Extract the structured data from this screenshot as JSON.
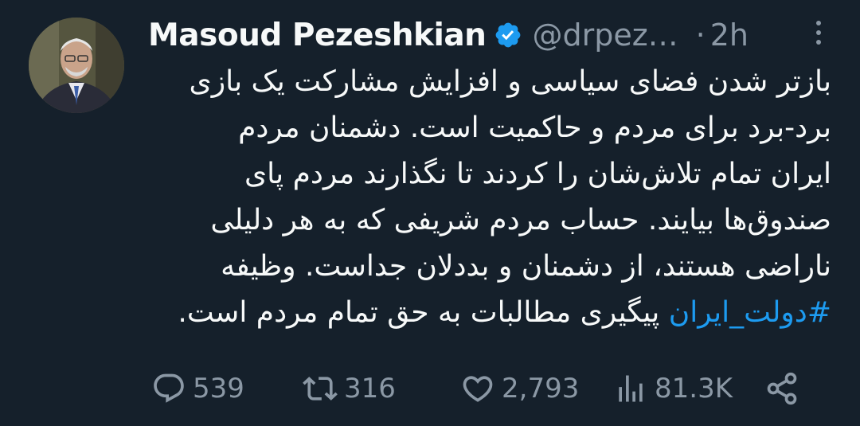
{
  "author": {
    "display_name": "Masoud Pezeshkian",
    "handle": "@drpez…",
    "separator": "·",
    "time": "2h",
    "verified_color": "#1d9bf0"
  },
  "tweet": {
    "lines": [
      "بازتر شدن فضای سیاسی و افزایش مشارکت یک بازی",
      "برد-برد برای مردم و حاکمیت است. دشمنان مردم",
      "ایران تمام تلاش‌شان را کردند تا نگذارند مردم پای",
      "صندوق‌ها بیایند. حساب مردم شریفی که به هر دلیلی",
      "ناراضی هستند، از دشمنان و بددلان جداست. وظیفه"
    ],
    "hashtag": "#دولت_ایران",
    "last_line_rest": "پیگیری مطالبات به حق تمام مردم است.",
    "link_color": "#1d9bf0"
  },
  "actions": {
    "reply_count": "539",
    "retweet_count": "316",
    "like_count": "2,793",
    "views_count": "81.3K"
  },
  "icons": {
    "avatar": "profile-photo",
    "verified": "verified-badge-icon",
    "more": "more-options-icon",
    "reply": "reply-icon",
    "retweet": "retweet-icon",
    "like": "heart-icon",
    "views": "views-chart-icon",
    "share": "share-icon"
  }
}
